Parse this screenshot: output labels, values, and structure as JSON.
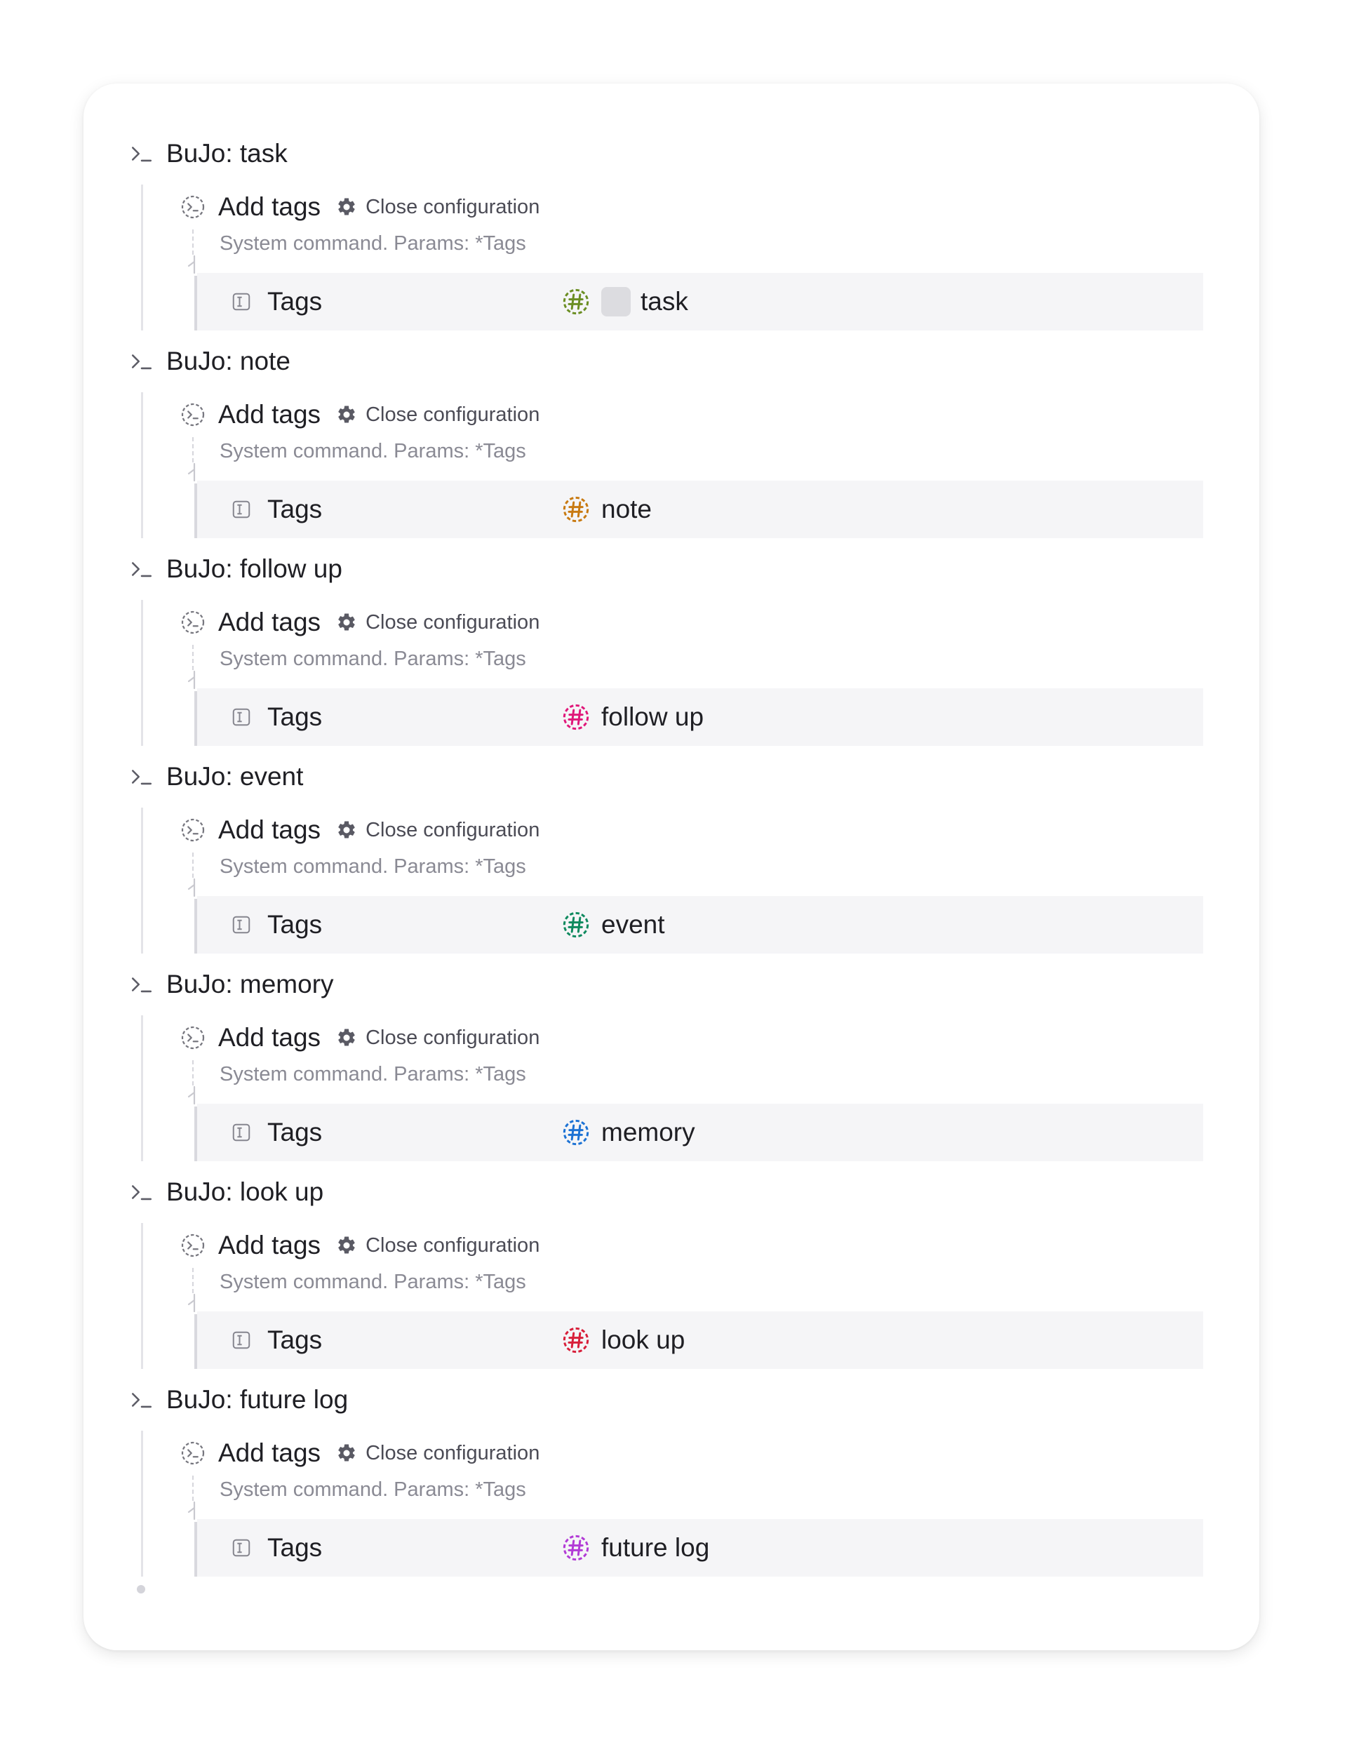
{
  "blocks": [
    {
      "title": "BuJo: task",
      "action": "Add tags",
      "config_label": "Close configuration",
      "description": "System command. Params: *Tags",
      "param_label": "Tags",
      "tag_value": "task",
      "tag_color": "#6b8e23",
      "has_swatch": true
    },
    {
      "title": "BuJo: note",
      "action": "Add tags",
      "config_label": "Close configuration",
      "description": "System command. Params: *Tags",
      "param_label": "Tags",
      "tag_value": "note",
      "tag_color": "#c87a12",
      "has_swatch": false
    },
    {
      "title": "BuJo: follow up",
      "action": "Add tags",
      "config_label": "Close configuration",
      "description": "System command. Params: *Tags",
      "param_label": "Tags",
      "tag_value": "follow up",
      "tag_color": "#e0187a",
      "has_swatch": false
    },
    {
      "title": "BuJo: event",
      "action": "Add tags",
      "config_label": "Close configuration",
      "description": "System command. Params: *Tags",
      "param_label": "Tags",
      "tag_value": "event",
      "tag_color": "#0f8a5f",
      "has_swatch": false
    },
    {
      "title": "BuJo: memory",
      "action": "Add tags",
      "config_label": "Close configuration",
      "description": "System command. Params: *Tags",
      "param_label": "Tags",
      "tag_value": "memory",
      "tag_color": "#1c72d4",
      "has_swatch": false
    },
    {
      "title": "BuJo: look up",
      "action": "Add tags",
      "config_label": "Close configuration",
      "description": "System command. Params: *Tags",
      "param_label": "Tags",
      "tag_value": "look up",
      "tag_color": "#d81f3a",
      "has_swatch": false
    },
    {
      "title": "BuJo: future log",
      "action": "Add tags",
      "config_label": "Close configuration",
      "description": "System command. Params: *Tags",
      "param_label": "Tags",
      "tag_value": "future log",
      "tag_color": "#b23bd6",
      "has_swatch": false
    }
  ]
}
